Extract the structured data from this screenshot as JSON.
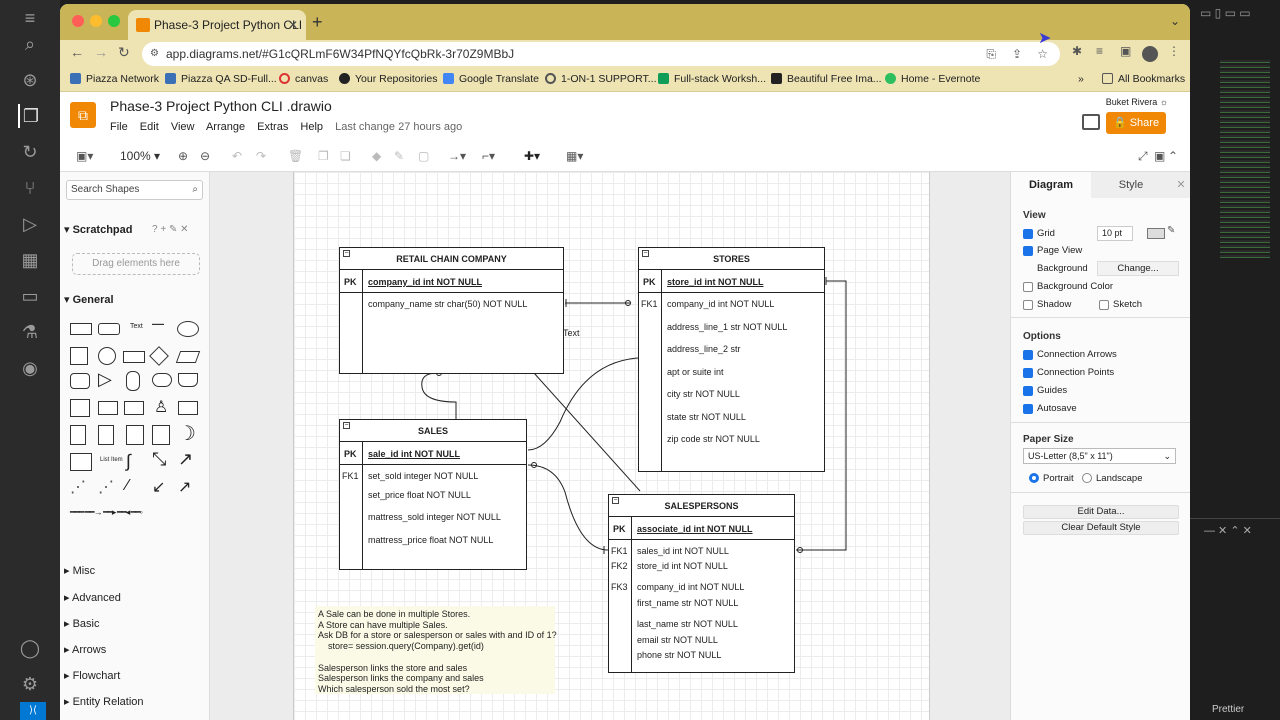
{
  "browser": {
    "tab_title": "Phase-3 Project Python CLI .d",
    "new_tab": "+",
    "url": "app.diagrams.net/#G1cQRLmF6W34PfNQYfcQbRk-3r70Z9MBbJ",
    "bookmarks": [
      "Piazza Network",
      "Piazza QA SD-Full...",
      "canvas",
      "Your Repositories",
      "Google Translate",
      "1-ON-1 SUPPORT...",
      "Full-stack Worksh...",
      "Beautiful Free Ima...",
      "Home - Evernote"
    ],
    "more": "»",
    "all_bookmarks": "All Bookmarks"
  },
  "app": {
    "title": "Phase-3 Project Python CLI .drawio",
    "menu": [
      "File",
      "Edit",
      "View",
      "Arrange",
      "Extras",
      "Help"
    ],
    "last_change": "Last change 27 hours ago",
    "user": "Buket Rivera",
    "share": "Share",
    "zoom": "100%"
  },
  "left": {
    "search_placeholder": "Search Shapes",
    "scratchpad": "Scratchpad",
    "scratchpad_controls": "? + ✎ ✕",
    "drag_hint": "Drag elements here",
    "general": "General",
    "sections": [
      "Misc",
      "Advanced",
      "Basic",
      "Arrows",
      "Flowchart",
      "Entity Relation"
    ]
  },
  "diagram": {
    "retail": {
      "title": "RETAIL CHAIN COMPANY",
      "pk": "PK",
      "pk_field": "company_id int NOT NULL",
      "fields": [
        "company_name str char(50) NOT NULL"
      ]
    },
    "stores": {
      "title": "STORES",
      "pk": "PK",
      "pk_field": "store_id int NOT NULL",
      "fk": "FK1",
      "fields": [
        "company_id int NOT NULL",
        "address_line_1 str NOT NULL",
        "address_line_2 str",
        "apt or suite int",
        "city str NOT NULL",
        "state str NOT NULL",
        "zip code str NOT NULL"
      ]
    },
    "sales": {
      "title": "SALES",
      "pk": "PK",
      "pk_field": "sale_id int NOT NULL",
      "fk": "FK1",
      "fields": [
        "set_sold integer NOT NULL",
        "set_price float NOT NULL",
        "mattress_sold integer NOT NULL",
        "mattress_price float NOT NULL"
      ]
    },
    "salespersons": {
      "title": "SALESPERSONS",
      "pk": "PK",
      "pk_field": "associate_id int NOT NULL",
      "fks": [
        "FK1",
        "FK2",
        "FK3"
      ],
      "fields": [
        "sales_id int NOT NULL",
        "store_id int NOT NULL",
        "company_id int NOT NULL",
        "first_name str NOT NULL",
        "last_name str NOT NULL",
        "email str NOT NULL",
        "phone str NOT NULL"
      ]
    },
    "floating_text": "Text",
    "note": "A Sale can be done in multiple Stores.\nA Store can have multiple Sales.\nAsk DB for a store or salesperson or sales with and ID of 1?\n    store= session.query(Company).get(id)\n\nSalesperson links the store and sales\nSalesperson links the company and sales\nWhich salesperson sold the most set?"
  },
  "right": {
    "tabs": [
      "Diagram",
      "Style"
    ],
    "view": "View",
    "grid": "Grid",
    "grid_size": "10 pt",
    "page_view": "Page View",
    "background": "Background",
    "change": "Change...",
    "background_color": "Background Color",
    "shadow": "Shadow",
    "sketch": "Sketch",
    "options": "Options",
    "option_items": [
      "Connection Arrows",
      "Connection Points",
      "Guides",
      "Autosave"
    ],
    "paper_size": "Paper Size",
    "paper_value": "US-Letter (8,5\" x 11\")",
    "portrait": "Portrait",
    "landscape": "Landscape",
    "edit_data": "Edit Data...",
    "clear_style": "Clear Default Style"
  },
  "vscode": {
    "status": "Prettier"
  }
}
